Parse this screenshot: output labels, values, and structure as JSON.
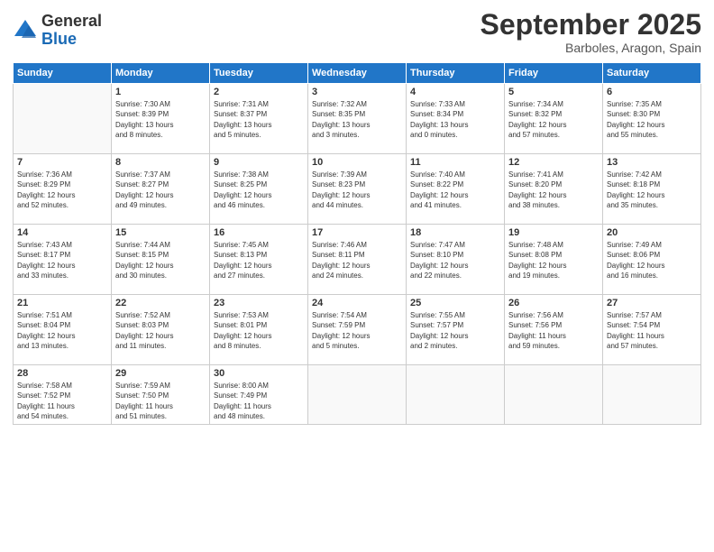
{
  "logo": {
    "general": "General",
    "blue": "Blue"
  },
  "title": "September 2025",
  "subtitle": "Barboles, Aragon, Spain",
  "days_header": [
    "Sunday",
    "Monday",
    "Tuesday",
    "Wednesday",
    "Thursday",
    "Friday",
    "Saturday"
  ],
  "weeks": [
    [
      {
        "num": "",
        "info": ""
      },
      {
        "num": "1",
        "info": "Sunrise: 7:30 AM\nSunset: 8:39 PM\nDaylight: 13 hours\nand 8 minutes."
      },
      {
        "num": "2",
        "info": "Sunrise: 7:31 AM\nSunset: 8:37 PM\nDaylight: 13 hours\nand 5 minutes."
      },
      {
        "num": "3",
        "info": "Sunrise: 7:32 AM\nSunset: 8:35 PM\nDaylight: 13 hours\nand 3 minutes."
      },
      {
        "num": "4",
        "info": "Sunrise: 7:33 AM\nSunset: 8:34 PM\nDaylight: 13 hours\nand 0 minutes."
      },
      {
        "num": "5",
        "info": "Sunrise: 7:34 AM\nSunset: 8:32 PM\nDaylight: 12 hours\nand 57 minutes."
      },
      {
        "num": "6",
        "info": "Sunrise: 7:35 AM\nSunset: 8:30 PM\nDaylight: 12 hours\nand 55 minutes."
      }
    ],
    [
      {
        "num": "7",
        "info": "Sunrise: 7:36 AM\nSunset: 8:29 PM\nDaylight: 12 hours\nand 52 minutes."
      },
      {
        "num": "8",
        "info": "Sunrise: 7:37 AM\nSunset: 8:27 PM\nDaylight: 12 hours\nand 49 minutes."
      },
      {
        "num": "9",
        "info": "Sunrise: 7:38 AM\nSunset: 8:25 PM\nDaylight: 12 hours\nand 46 minutes."
      },
      {
        "num": "10",
        "info": "Sunrise: 7:39 AM\nSunset: 8:23 PM\nDaylight: 12 hours\nand 44 minutes."
      },
      {
        "num": "11",
        "info": "Sunrise: 7:40 AM\nSunset: 8:22 PM\nDaylight: 12 hours\nand 41 minutes."
      },
      {
        "num": "12",
        "info": "Sunrise: 7:41 AM\nSunset: 8:20 PM\nDaylight: 12 hours\nand 38 minutes."
      },
      {
        "num": "13",
        "info": "Sunrise: 7:42 AM\nSunset: 8:18 PM\nDaylight: 12 hours\nand 35 minutes."
      }
    ],
    [
      {
        "num": "14",
        "info": "Sunrise: 7:43 AM\nSunset: 8:17 PM\nDaylight: 12 hours\nand 33 minutes."
      },
      {
        "num": "15",
        "info": "Sunrise: 7:44 AM\nSunset: 8:15 PM\nDaylight: 12 hours\nand 30 minutes."
      },
      {
        "num": "16",
        "info": "Sunrise: 7:45 AM\nSunset: 8:13 PM\nDaylight: 12 hours\nand 27 minutes."
      },
      {
        "num": "17",
        "info": "Sunrise: 7:46 AM\nSunset: 8:11 PM\nDaylight: 12 hours\nand 24 minutes."
      },
      {
        "num": "18",
        "info": "Sunrise: 7:47 AM\nSunset: 8:10 PM\nDaylight: 12 hours\nand 22 minutes."
      },
      {
        "num": "19",
        "info": "Sunrise: 7:48 AM\nSunset: 8:08 PM\nDaylight: 12 hours\nand 19 minutes."
      },
      {
        "num": "20",
        "info": "Sunrise: 7:49 AM\nSunset: 8:06 PM\nDaylight: 12 hours\nand 16 minutes."
      }
    ],
    [
      {
        "num": "21",
        "info": "Sunrise: 7:51 AM\nSunset: 8:04 PM\nDaylight: 12 hours\nand 13 minutes."
      },
      {
        "num": "22",
        "info": "Sunrise: 7:52 AM\nSunset: 8:03 PM\nDaylight: 12 hours\nand 11 minutes."
      },
      {
        "num": "23",
        "info": "Sunrise: 7:53 AM\nSunset: 8:01 PM\nDaylight: 12 hours\nand 8 minutes."
      },
      {
        "num": "24",
        "info": "Sunrise: 7:54 AM\nSunset: 7:59 PM\nDaylight: 12 hours\nand 5 minutes."
      },
      {
        "num": "25",
        "info": "Sunrise: 7:55 AM\nSunset: 7:57 PM\nDaylight: 12 hours\nand 2 minutes."
      },
      {
        "num": "26",
        "info": "Sunrise: 7:56 AM\nSunset: 7:56 PM\nDaylight: 11 hours\nand 59 minutes."
      },
      {
        "num": "27",
        "info": "Sunrise: 7:57 AM\nSunset: 7:54 PM\nDaylight: 11 hours\nand 57 minutes."
      }
    ],
    [
      {
        "num": "28",
        "info": "Sunrise: 7:58 AM\nSunset: 7:52 PM\nDaylight: 11 hours\nand 54 minutes."
      },
      {
        "num": "29",
        "info": "Sunrise: 7:59 AM\nSunset: 7:50 PM\nDaylight: 11 hours\nand 51 minutes."
      },
      {
        "num": "30",
        "info": "Sunrise: 8:00 AM\nSunset: 7:49 PM\nDaylight: 11 hours\nand 48 minutes."
      },
      {
        "num": "",
        "info": ""
      },
      {
        "num": "",
        "info": ""
      },
      {
        "num": "",
        "info": ""
      },
      {
        "num": "",
        "info": ""
      }
    ]
  ]
}
